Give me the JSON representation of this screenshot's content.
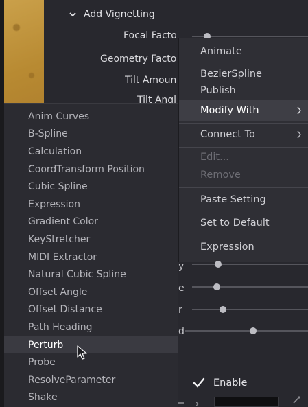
{
  "section": {
    "title": "Add Vignetting"
  },
  "params": {
    "focal_factor": "Focal Factor",
    "geometry_factor": "Geometry Facto",
    "tilt_amount": "Tilt Amoun",
    "tilt_angle": "Tilt Angl"
  },
  "context_menu": {
    "animate": "Animate",
    "bezier_spline": "BezierSpline",
    "publish": "Publish",
    "modify_with": "Modify With",
    "connect_to": "Connect To",
    "edit": "Edit...",
    "remove": "Remove",
    "paste_setting": "Paste Setting",
    "set_to_default": "Set to Default",
    "expression": "Expression"
  },
  "submenu": {
    "items": [
      "Anim Curves",
      "B-Spline",
      "Calculation",
      "CoordTransform Position",
      "Cubic Spline",
      "Expression",
      "Gradient Color",
      "KeyStretcher",
      "MIDI Extractor",
      "Natural Cubic Spline",
      "Offset Angle",
      "Offset Distance",
      "Path Heading",
      "Perturb",
      "Probe",
      "ResolveParameter",
      "Shake"
    ],
    "hovered": "Perturb"
  },
  "fragments": {
    "f1": "y",
    "f2": "e",
    "f3": "r",
    "f4": "d"
  },
  "enable": {
    "label": "Enable",
    "checked": true
  },
  "icons": {
    "chevron": "chevron-down-icon",
    "submenu_arrow": "chevron-right-icon",
    "cursor": "mouse-pointer-icon",
    "check": "checkmark-icon",
    "picker": "eyedropper-icon"
  }
}
